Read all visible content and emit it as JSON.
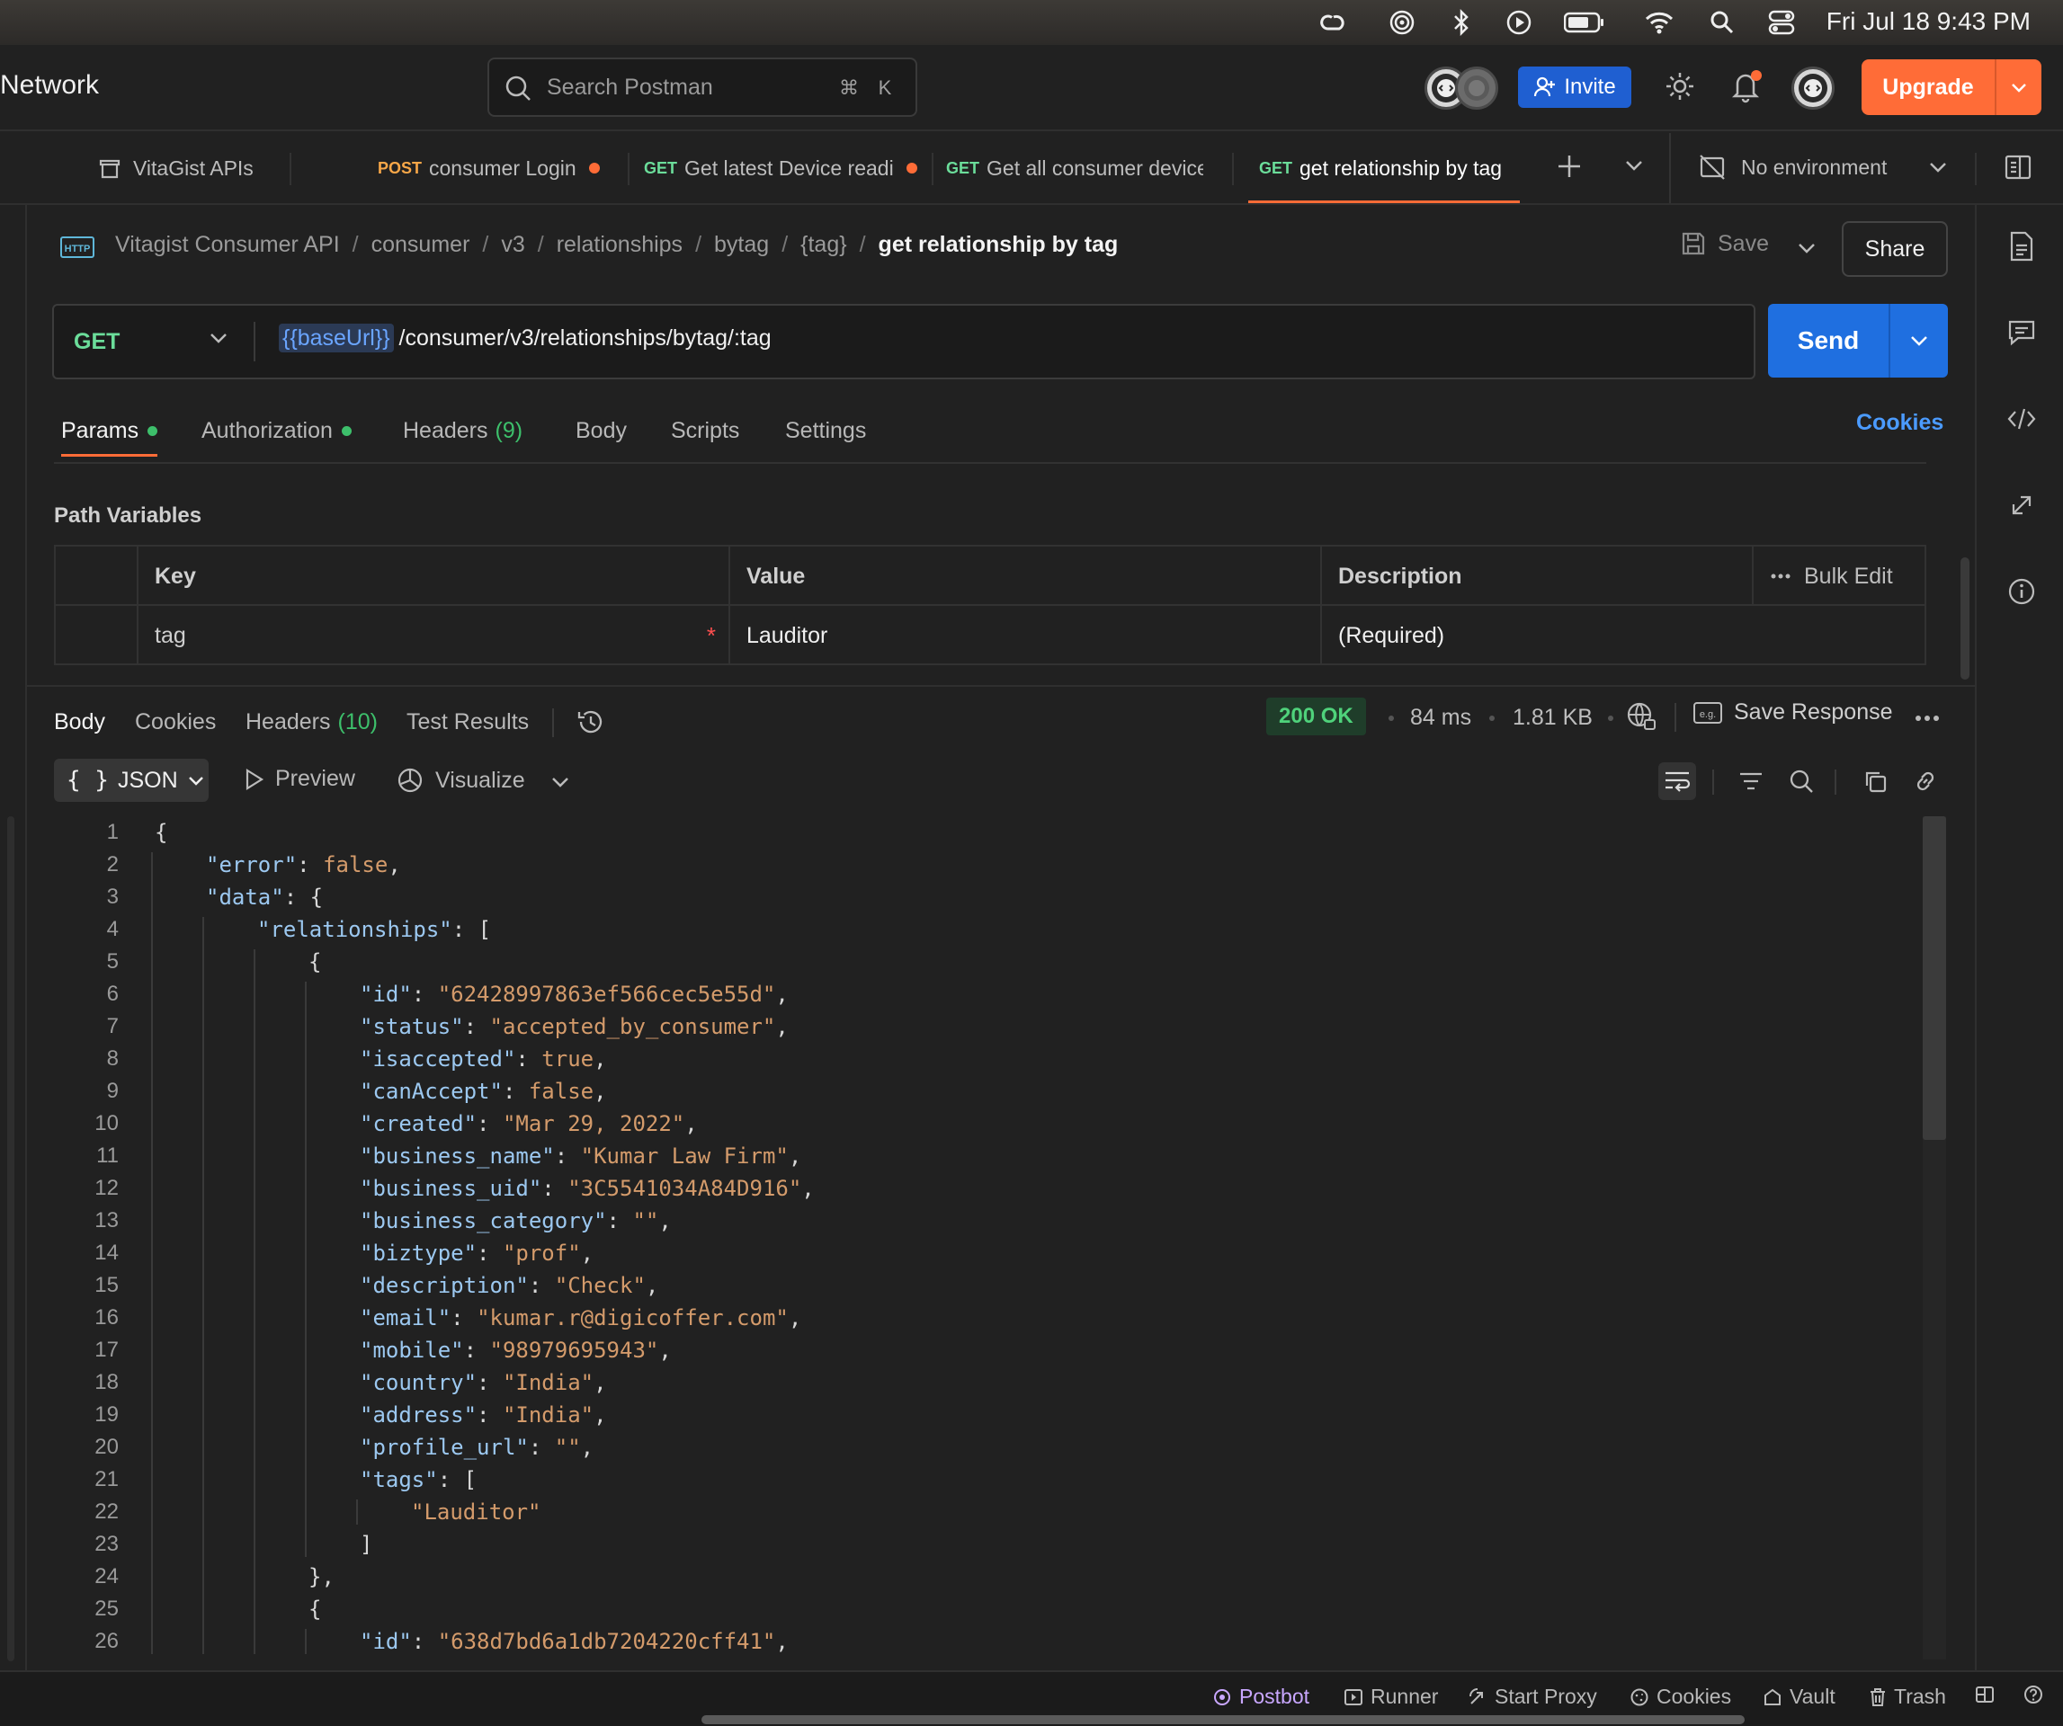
{
  "menubar": {
    "clock": "Fri Jul 18  9:43 PM",
    "icons": [
      "creative-cloud-icon",
      "airdrop-icon",
      "bluetooth-icon",
      "play-icon",
      "battery-icon",
      "wifi-icon",
      "spotlight-search-icon",
      "control-center-icon"
    ]
  },
  "header": {
    "workspace_title": "Network",
    "search_placeholder": "Search Postman",
    "search_kbd_1": "⌘",
    "search_kbd_2": "K",
    "invite_label": "Invite",
    "upgrade_label": "Upgrade"
  },
  "tabs": [
    {
      "method": "",
      "label": "VitaGist APIs",
      "unsaved": false,
      "active": false
    },
    {
      "method": "POST",
      "label": "consumer Login",
      "unsaved": true,
      "active": false
    },
    {
      "method": "GET",
      "label": "Get latest Device readi",
      "unsaved": true,
      "active": false
    },
    {
      "method": "GET",
      "label": "Get all consumer device",
      "unsaved": false,
      "active": false
    },
    {
      "method": "GET",
      "label": "get relationship by tag",
      "unsaved": false,
      "active": true
    }
  ],
  "environment": {
    "label": "No environment"
  },
  "breadcrumb": {
    "items": [
      "Vitagist Consumer API",
      "consumer",
      "v3",
      "relationships",
      "bytag",
      "{tag}"
    ],
    "separator": "/",
    "current": "get relationship by tag",
    "badge": "HTTP"
  },
  "request": {
    "save_label": "Save",
    "share_label": "Share",
    "method": "GET",
    "url_var": "{{baseUrl}}",
    "url_path": "/consumer/v3/relationships/bytag/:tag",
    "send_label": "Send",
    "tabs": {
      "params": "Params",
      "authorization": "Authorization",
      "headers": "Headers",
      "headers_count": "(9)",
      "body": "Body",
      "scripts": "Scripts",
      "settings": "Settings"
    },
    "cookies_label": "Cookies",
    "path_variables": {
      "title": "Path Variables",
      "columns": {
        "key": "Key",
        "value": "Value",
        "description": "Description",
        "bulk_edit": "Bulk Edit"
      },
      "rows": [
        {
          "key": "tag",
          "value": "Lauditor",
          "description": "(Required)"
        }
      ]
    }
  },
  "response": {
    "tabs": {
      "body": "Body",
      "cookies": "Cookies",
      "headers": "Headers",
      "headers_count": "(10)",
      "test_results": "Test Results"
    },
    "status": "200 OK",
    "time": "84 ms",
    "size": "1.81 KB",
    "save_response_label": "Save Response",
    "format": "JSON",
    "preview_label": "Preview",
    "visualize_label": "Visualize"
  },
  "statusbar": {
    "postbot": "Postbot",
    "runner": "Runner",
    "start_proxy": "Start Proxy",
    "cookies": "Cookies",
    "vault": "Vault",
    "trash": "Trash"
  },
  "code_lines": [
    [
      [
        "p",
        "{"
      ]
    ],
    [
      [
        "k",
        "\"error\""
      ],
      [
        "p",
        ": "
      ],
      [
        "b",
        "false"
      ],
      [
        "p",
        ","
      ]
    ],
    [
      [
        "k",
        "\"data\""
      ],
      [
        "p",
        ": {"
      ]
    ],
    [
      [
        "k",
        "\"relationships\""
      ],
      [
        "p",
        ": ["
      ]
    ],
    [
      [
        "p",
        "{"
      ]
    ],
    [
      [
        "k",
        "\"id\""
      ],
      [
        "p",
        ": "
      ],
      [
        "s",
        "\"62428997863ef566cec5e55d\""
      ],
      [
        "p",
        ","
      ]
    ],
    [
      [
        "k",
        "\"status\""
      ],
      [
        "p",
        ": "
      ],
      [
        "s",
        "\"accepted_by_consumer\""
      ],
      [
        "p",
        ","
      ]
    ],
    [
      [
        "k",
        "\"isaccepted\""
      ],
      [
        "p",
        ": "
      ],
      [
        "b",
        "true"
      ],
      [
        "p",
        ","
      ]
    ],
    [
      [
        "k",
        "\"canAccept\""
      ],
      [
        "p",
        ": "
      ],
      [
        "b",
        "false"
      ],
      [
        "p",
        ","
      ]
    ],
    [
      [
        "k",
        "\"created\""
      ],
      [
        "p",
        ": "
      ],
      [
        "s",
        "\"Mar 29, 2022\""
      ],
      [
        "p",
        ","
      ]
    ],
    [
      [
        "k",
        "\"business_name\""
      ],
      [
        "p",
        ": "
      ],
      [
        "s",
        "\"Kumar Law Firm\""
      ],
      [
        "p",
        ","
      ]
    ],
    [
      [
        "k",
        "\"business_uid\""
      ],
      [
        "p",
        ": "
      ],
      [
        "s",
        "\"3C5541034A84D916\""
      ],
      [
        "p",
        ","
      ]
    ],
    [
      [
        "k",
        "\"business_category\""
      ],
      [
        "p",
        ": "
      ],
      [
        "s",
        "\"\""
      ],
      [
        "p",
        ","
      ]
    ],
    [
      [
        "k",
        "\"biztype\""
      ],
      [
        "p",
        ": "
      ],
      [
        "s",
        "\"prof\""
      ],
      [
        "p",
        ","
      ]
    ],
    [
      [
        "k",
        "\"description\""
      ],
      [
        "p",
        ": "
      ],
      [
        "s",
        "\"Check\""
      ],
      [
        "p",
        ","
      ]
    ],
    [
      [
        "k",
        "\"email\""
      ],
      [
        "p",
        ": "
      ],
      [
        "s",
        "\"kumar.r@digicoffer.com\""
      ],
      [
        "p",
        ","
      ]
    ],
    [
      [
        "k",
        "\"mobile\""
      ],
      [
        "p",
        ": "
      ],
      [
        "s",
        "\"98979695943\""
      ],
      [
        "p",
        ","
      ]
    ],
    [
      [
        "k",
        "\"country\""
      ],
      [
        "p",
        ": "
      ],
      [
        "s",
        "\"India\""
      ],
      [
        "p",
        ","
      ]
    ],
    [
      [
        "k",
        "\"address\""
      ],
      [
        "p",
        ": "
      ],
      [
        "s",
        "\"India\""
      ],
      [
        "p",
        ","
      ]
    ],
    [
      [
        "k",
        "\"profile_url\""
      ],
      [
        "p",
        ": "
      ],
      [
        "s",
        "\"\""
      ],
      [
        "p",
        ","
      ]
    ],
    [
      [
        "k",
        "\"tags\""
      ],
      [
        "p",
        ": ["
      ]
    ],
    [
      [
        "s",
        "\"Lauditor\""
      ]
    ],
    [
      [
        "p",
        "]"
      ]
    ],
    [
      [
        "p",
        "},"
      ]
    ],
    [
      [
        "p",
        "{"
      ]
    ],
    [
      [
        "k",
        "\"id\""
      ],
      [
        "p",
        ": "
      ],
      [
        "s",
        "\"638d7bd6a1db7204220cff41\""
      ],
      [
        "p",
        ","
      ]
    ]
  ],
  "code_indent": [
    0,
    1,
    1,
    2,
    3,
    4,
    4,
    4,
    4,
    4,
    4,
    4,
    4,
    4,
    4,
    4,
    4,
    4,
    4,
    4,
    4,
    5,
    4,
    3,
    3,
    4
  ]
}
